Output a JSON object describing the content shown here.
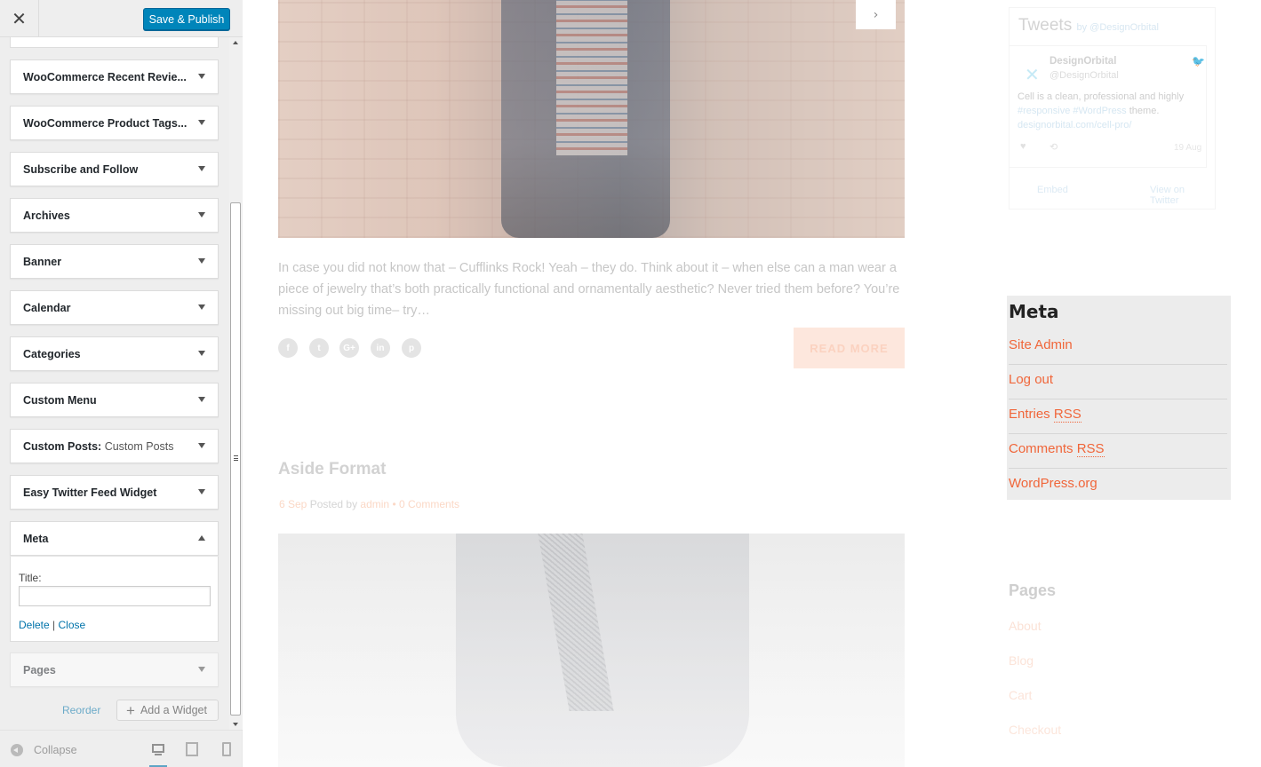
{
  "header": {
    "close_label": "✕",
    "publish_label": "Save & Publish"
  },
  "widgets": [
    {
      "label": "WooCommerce Recent Revie..."
    },
    {
      "label": "WooCommerce Product Tags..."
    },
    {
      "label": "Subscribe and Follow"
    },
    {
      "label": "Archives"
    },
    {
      "label": "Banner"
    },
    {
      "label": "Calendar"
    },
    {
      "label": "Categories"
    },
    {
      "label": "Custom Menu"
    },
    {
      "label": "Custom Posts:",
      "sub": "Custom Posts"
    },
    {
      "label": "Easy Twitter Feed Widget"
    },
    {
      "label": "Meta"
    },
    {
      "label": "Pages"
    }
  ],
  "meta_form": {
    "title_label": "Title:",
    "title_value": "",
    "delete_label": "Delete",
    "separator": "|",
    "close_label": "Close"
  },
  "actions": {
    "reorder_label": "Reorder",
    "add_widget_label": "Add a Widget"
  },
  "footer": {
    "collapse_label": "Collapse"
  },
  "post": {
    "excerpt": "In case you did not know that  – Cufflinks Rock! Yeah – they do. Think about it – when else can a man wear a piece of jewelry that’s both practically functional and ornamentally aesthetic? Never tried them before? You’re missing out big time– try…",
    "share_icons": [
      "f",
      "t",
      "G+",
      "in",
      "p"
    ],
    "read_more_label": "READ MORE",
    "next_icon": "›"
  },
  "aside": {
    "title": "Aside Format",
    "date": "6 Sep",
    "posted_by": "Posted by",
    "author": "admin",
    "bullet": "•",
    "comments": "0 Comments"
  },
  "tweets": {
    "heading": "Tweets",
    "by": "by @DesignOrbital",
    "name": "DesignOrbital",
    "handle": "@DesignOrbital",
    "text_1": "Cell is a clean, professional and highly",
    "link_1": "#responsive #WordPress",
    "text_2": " theme.",
    "link_2": "designorbital.com/cell-pro/",
    "time": "19 Aug",
    "embed_label": "Embed",
    "view_label": "View on Twitter"
  },
  "meta_widget": {
    "heading": "Meta",
    "links": [
      {
        "text": "Site Admin"
      },
      {
        "text": "Log out"
      },
      {
        "text": "Entries ",
        "abbr": "RSS"
      },
      {
        "text": "Comments ",
        "abbr": "RSS"
      },
      {
        "text": "WordPress.org"
      }
    ]
  },
  "pages_widget": {
    "heading": "Pages",
    "links": [
      "About",
      "Blog",
      "Cart",
      "Checkout"
    ]
  },
  "colors": {
    "accent": "#0085ba",
    "link": "#0073aa",
    "theme_link": "#f0663a"
  }
}
